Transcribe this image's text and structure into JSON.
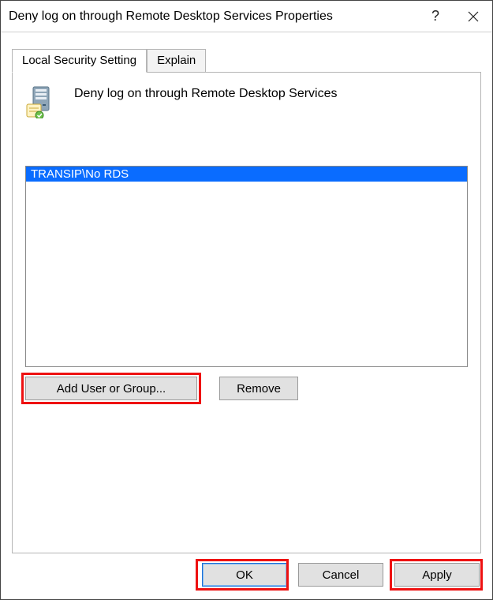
{
  "window": {
    "title": "Deny log on through Remote Desktop Services Properties",
    "help_label": "?",
    "close_label": "✕"
  },
  "tabs": {
    "local": "Local Security Setting",
    "explain": "Explain"
  },
  "policy": {
    "title": "Deny log on through Remote Desktop Services"
  },
  "list": {
    "items": [
      "TRANSIP\\No RDS"
    ]
  },
  "buttons": {
    "add": "Add User or Group...",
    "remove": "Remove",
    "ok": "OK",
    "cancel": "Cancel",
    "apply": "Apply"
  }
}
